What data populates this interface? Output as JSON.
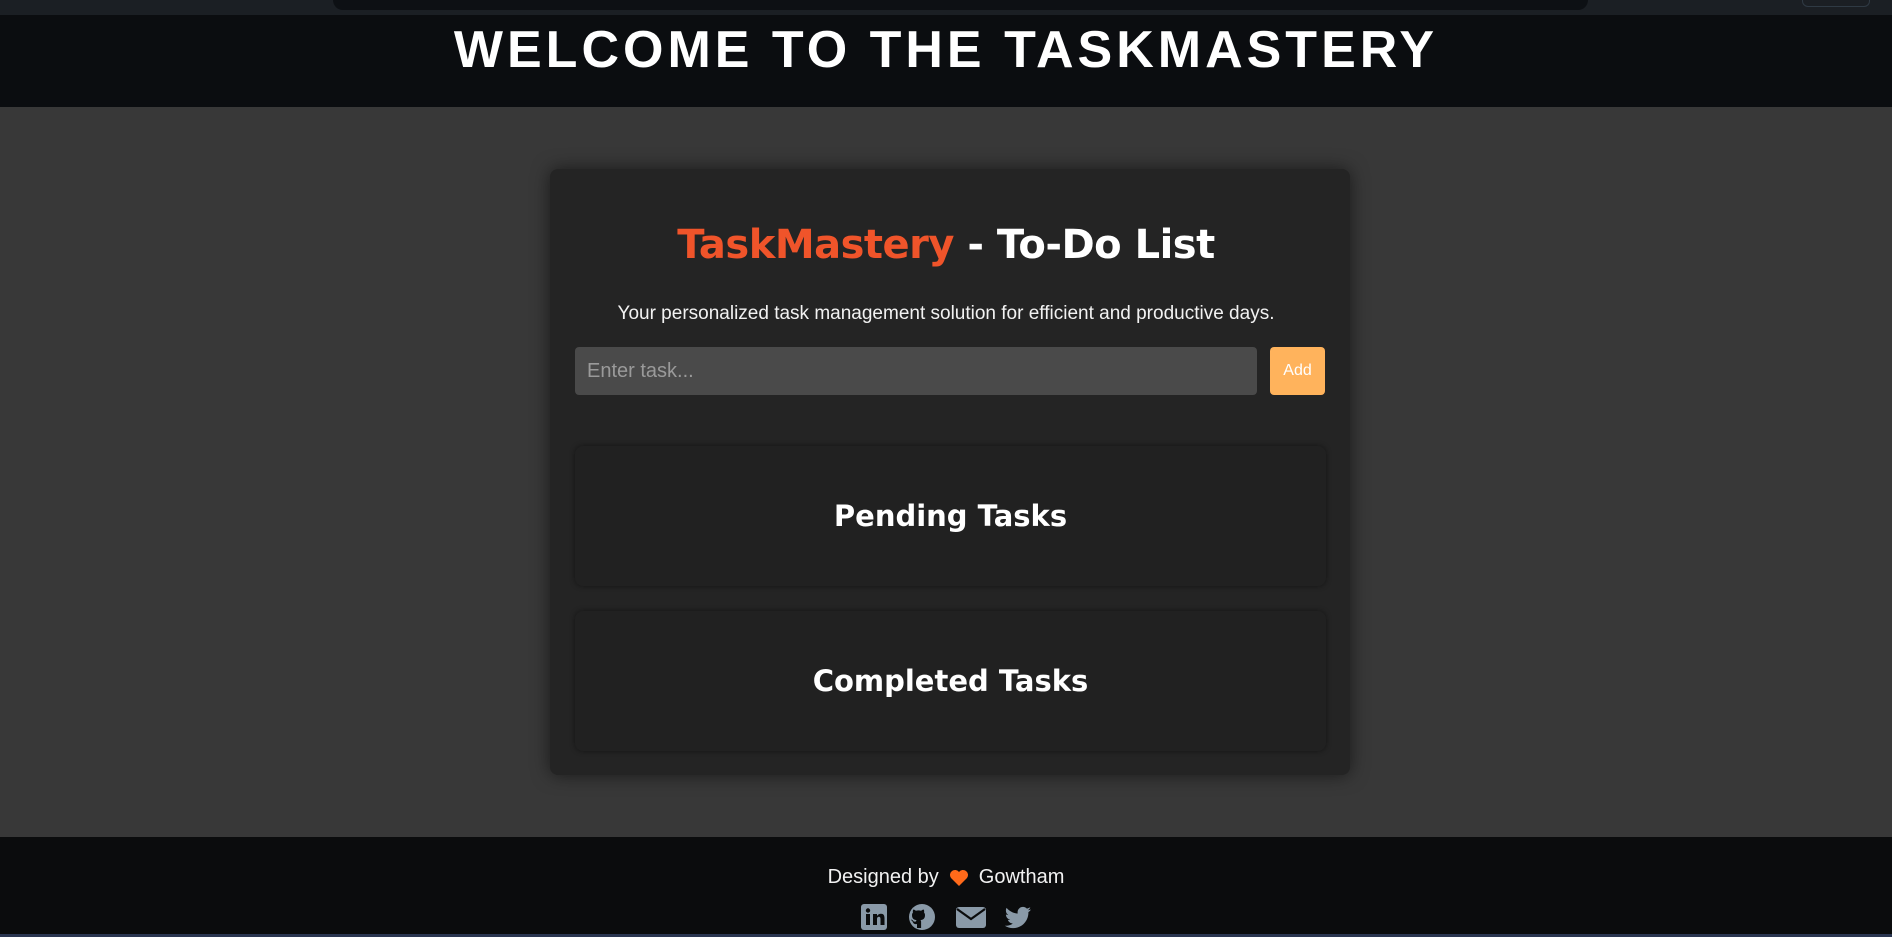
{
  "header": {
    "title": "WELCOME TO THE TASKMASTERY"
  },
  "card": {
    "brand": "TaskMastery",
    "title_rest": " - To-Do List",
    "subtitle": "Your personalized task management solution for efficient and productive days.",
    "input_placeholder": "Enter task...",
    "add_label": "Add"
  },
  "sections": {
    "pending": "Pending Tasks",
    "completed": "Completed Tasks"
  },
  "footer": {
    "designed_by": "Designed by",
    "author": "Gowtham",
    "icons": [
      "linkedin-icon",
      "github-icon",
      "email-icon",
      "twitter-icon"
    ]
  },
  "colors": {
    "brand": "#f0542a",
    "add_button": "#ffb35c",
    "heart": "#ff6a1a",
    "social_icons": "#8a9aa8"
  }
}
